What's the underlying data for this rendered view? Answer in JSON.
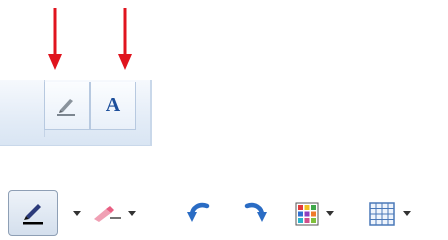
{
  "annotations": {
    "arrow_color": "#e0141e",
    "arrows": [
      "red-down-arrow-1",
      "red-down-arrow-2"
    ]
  },
  "ribbon": {
    "pen_icon": "pen-icon",
    "font_button_text": "A",
    "accent": "#1d4f9b"
  },
  "toolbar": {
    "items": [
      {
        "name": "pen-tool",
        "icon": "pen-icon",
        "active": true
      },
      {
        "name": "eraser-tool",
        "icon": "eraser-icon"
      },
      {
        "name": "undo",
        "icon": "undo-icon"
      },
      {
        "name": "redo",
        "icon": "redo-icon"
      },
      {
        "name": "color-palette",
        "icon": "color-grid-icon"
      },
      {
        "name": "table-grid",
        "icon": "table-grid-icon"
      }
    ]
  }
}
